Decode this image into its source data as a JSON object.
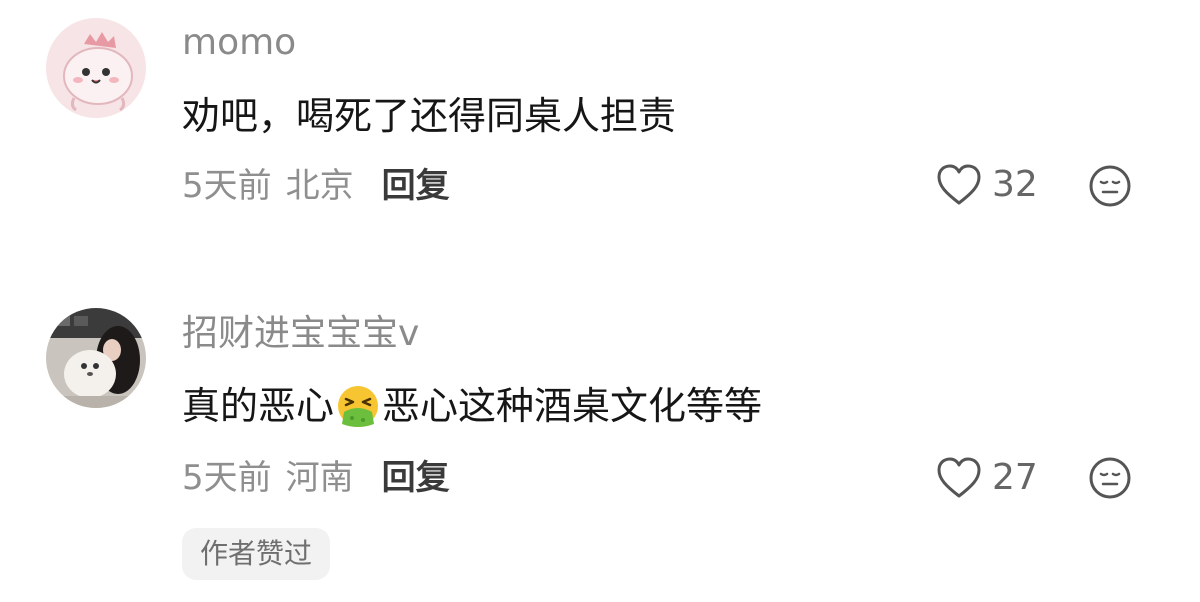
{
  "comments": [
    {
      "username": "momo",
      "text": "劝吧，喝死了还得同桌人担责",
      "time": "5天前",
      "location": "北京",
      "reply_label": "回复",
      "likes": "32",
      "avatar": "cartoon-dinosaur-avatar"
    },
    {
      "username": "招财进宝宝宝v",
      "text_before_emoji": "真的恶心",
      "emoji": "vomiting-face-emoji",
      "text_after_emoji": "恶心这种酒桌文化等等",
      "time": "5天前",
      "location": "河南",
      "reply_label": "回复",
      "likes": "27",
      "avatar": "photo-girl-with-dog-avatar",
      "badge": "作者赞过"
    }
  ],
  "colors": {
    "username": "#8a8a8a",
    "text": "#161616",
    "meta": "#8f8f8f",
    "reply": "#3a3a3a",
    "badge_bg": "#f2f2f2"
  }
}
